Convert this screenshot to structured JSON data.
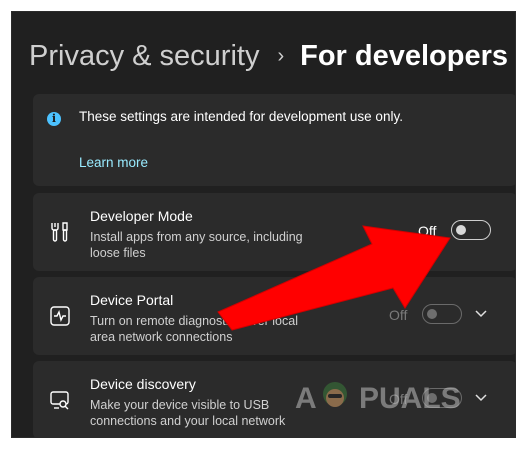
{
  "breadcrumb": {
    "parent": "Privacy & security",
    "separator": "›",
    "current": "For developers"
  },
  "info": {
    "icon": "info-icon",
    "text": "These settings are intended for development use only.",
    "link": "Learn more"
  },
  "settings": [
    {
      "icon": "tools-icon",
      "title": "Developer Mode",
      "description": "Install apps from any source, including loose files",
      "state": "Off",
      "enabled": false,
      "expandable": false
    },
    {
      "icon": "pulse-monitor-icon",
      "title": "Device Portal",
      "description": "Turn on remote diagnostics over local area network connections",
      "state": "Off",
      "enabled": false,
      "disabled": true,
      "expandable": true
    },
    {
      "icon": "screen-search-icon",
      "title": "Device discovery",
      "description": "Make your device visible to USB connections and your local network",
      "state": "Off",
      "enabled": false,
      "disabled": true,
      "expandable": true
    }
  ],
  "annotation": {
    "type": "red-arrow",
    "color": "#ff0000",
    "points_to": "developer-mode-toggle"
  },
  "watermark": {
    "text": "APPUALS"
  },
  "colors": {
    "background": "#202020",
    "card": "#2b2b2b",
    "accent": "#4cc2ff",
    "link": "#99ebff",
    "annotation_red": "#ff0000"
  }
}
